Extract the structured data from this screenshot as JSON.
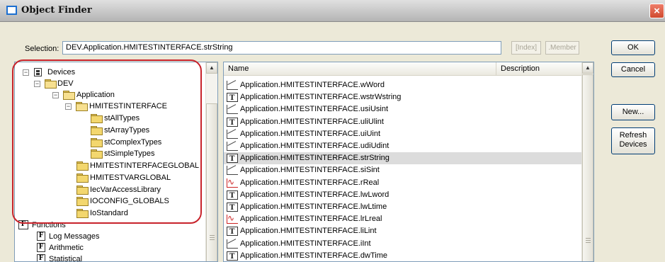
{
  "window": {
    "title": "Object Finder"
  },
  "selection": {
    "label": "Selection:",
    "value": "DEV.Application.HMITESTINTERFACE.strString"
  },
  "buttons": {
    "index": "[Index]",
    "member": ".Member",
    "ok": "OK",
    "cancel": "Cancel",
    "new": "New...",
    "refresh_line1": "Refresh",
    "refresh_line2": "Devices"
  },
  "tree": {
    "devices": "Devices",
    "dev": "DEV",
    "application": "Application",
    "hmitestinterface": "HMITESTINTERFACE",
    "children": [
      "stAllTypes",
      "stArrayTypes",
      "stComplexTypes",
      "stSimpleTypes"
    ],
    "siblings": [
      "HMITESTINTERFACEGLOBAL",
      "HMITESTVARGLOBAL",
      "IecVarAccessLibrary",
      "IOCONFIG_GLOBALS",
      "IoStandard"
    ],
    "functions": "Functions",
    "function_items": [
      "Log Messages",
      "Arithmetic",
      "Statistical"
    ]
  },
  "list": {
    "columns": {
      "name": "Name",
      "description": "Description"
    },
    "rows": [
      {
        "name": "Application.HMITESTINTERFACE.wWord",
        "icon": "line-icon"
      },
      {
        "name": "Application.HMITESTINTERFACE.wstrWstring",
        "icon": "text-icon"
      },
      {
        "name": "Application.HMITESTINTERFACE.usiUsint",
        "icon": "line-icon"
      },
      {
        "name": "Application.HMITESTINTERFACE.uliUlint",
        "icon": "text-icon"
      },
      {
        "name": "Application.HMITESTINTERFACE.uiUint",
        "icon": "line-icon"
      },
      {
        "name": "Application.HMITESTINTERFACE.udiUdint",
        "icon": "line-icon"
      },
      {
        "name": "Application.HMITESTINTERFACE.strString",
        "icon": "text-icon",
        "selected": true
      },
      {
        "name": "Application.HMITESTINTERFACE.siSint",
        "icon": "line-icon"
      },
      {
        "name": "Application.HMITESTINTERFACE.rReal",
        "icon": "real-icon"
      },
      {
        "name": "Application.HMITESTINTERFACE.lwLword",
        "icon": "text-icon"
      },
      {
        "name": "Application.HMITESTINTERFACE.lwLtime",
        "icon": "text-icon"
      },
      {
        "name": "Application.HMITESTINTERFACE.lrLreal",
        "icon": "real-icon"
      },
      {
        "name": "Application.HMITESTINTERFACE.liLint",
        "icon": "text-icon"
      },
      {
        "name": "Application.HMITESTINTERFACE.iInt",
        "icon": "line-icon"
      },
      {
        "name": "Application.HMITESTINTERFACE.dwTime",
        "icon": "text-icon"
      }
    ]
  },
  "colors": {
    "accent_highlight": "#c8232b",
    "title_icon": "#1c6fd1",
    "close_button": "#d04a2e"
  }
}
